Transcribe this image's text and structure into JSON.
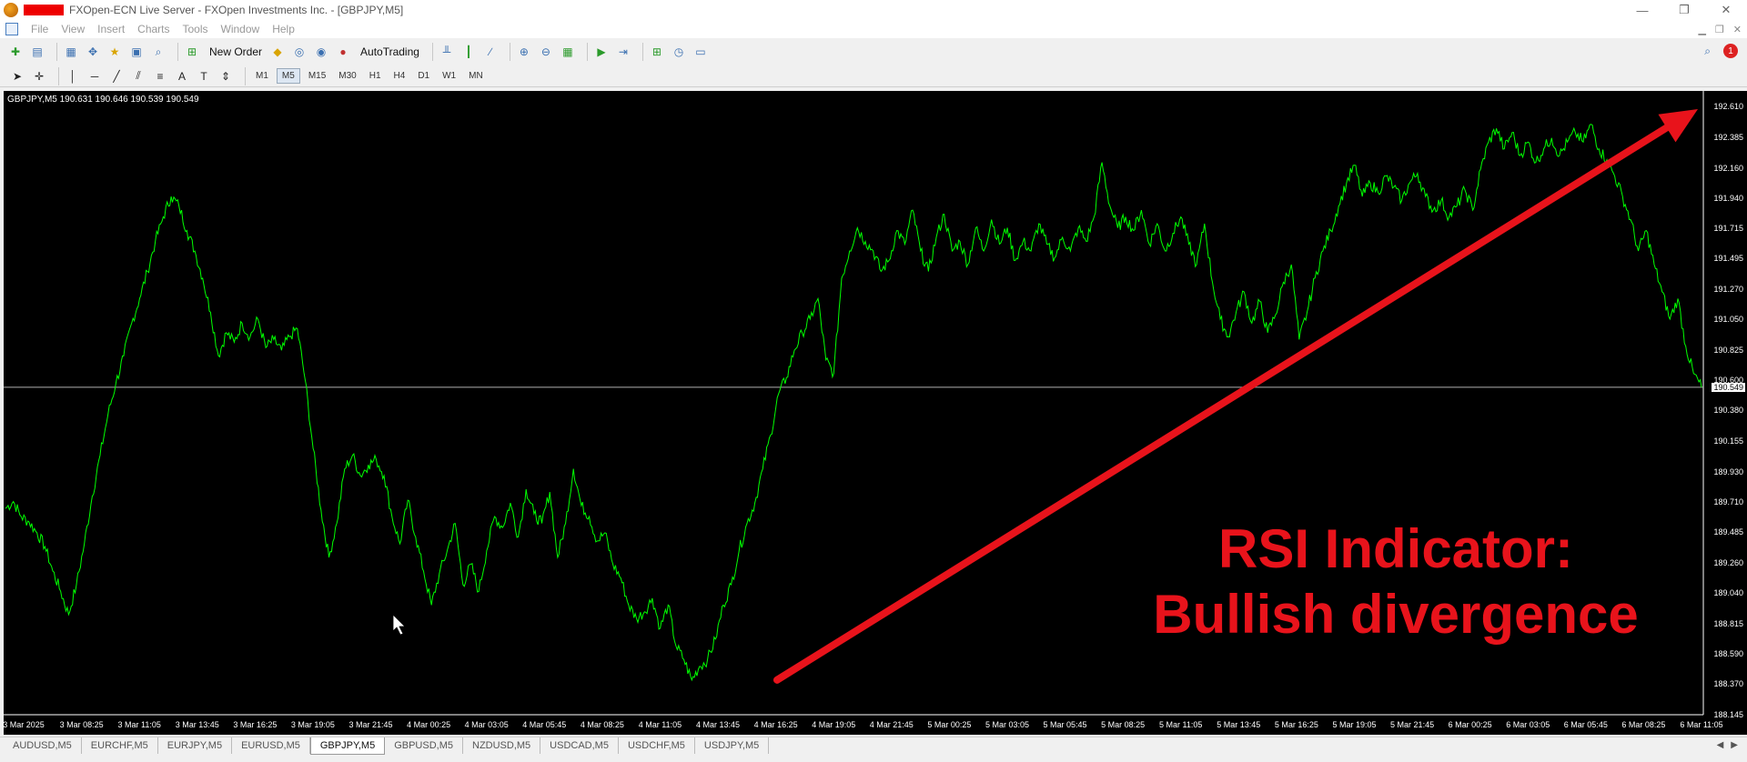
{
  "window": {
    "title": "FXOpen-ECN Live Server - FXOpen Investments Inc. - [GBPJPY,M5]",
    "controls": [
      "—",
      "❐",
      "✕"
    ]
  },
  "menu": {
    "items": [
      "File",
      "View",
      "Insert",
      "Charts",
      "Tools",
      "Window",
      "Help"
    ]
  },
  "toolbar": {
    "new_order_label": "New Order",
    "autotrading_label": "AutoTrading",
    "notification_count": "1"
  },
  "timeframes": {
    "items": [
      "M1",
      "M5",
      "M15",
      "M30",
      "H1",
      "H4",
      "D1",
      "W1",
      "MN"
    ],
    "active": "M5"
  },
  "chart": {
    "info_label": "GBPJPY,M5  190.631 190.646 190.539 190.549",
    "current_price": "190.549",
    "line_color": "#00ff00",
    "background": "#000000",
    "annotation_line1": "RSI Indicator:",
    "annotation_line2": "Bullish divergence",
    "annotation_color": "#e8131b",
    "arrow_color": "#e8131b"
  },
  "chart_data": {
    "type": "line",
    "series": [
      {
        "values": [
          189.66,
          189.71,
          189.6,
          189.56,
          189.48,
          189.38,
          189.2,
          189.05,
          188.88,
          189.1,
          189.4,
          189.75,
          190.05,
          190.35,
          190.58,
          190.78,
          191.02,
          191.2,
          191.4,
          191.62,
          191.8,
          191.95,
          191.88,
          191.7,
          191.55,
          191.35,
          191.1,
          190.78,
          190.95,
          190.88,
          191.02,
          190.92,
          191.05,
          190.84,
          190.9,
          190.82,
          190.92,
          190.98,
          190.6,
          190.1,
          189.65,
          189.3,
          189.55,
          189.95,
          190.05,
          189.9,
          189.98,
          190.02,
          189.9,
          189.6,
          189.4,
          189.72,
          189.45,
          189.2,
          188.95,
          189.18,
          189.35,
          189.55,
          189.1,
          189.25,
          189.05,
          189.35,
          189.6,
          189.52,
          189.7,
          189.45,
          189.8,
          189.62,
          189.55,
          189.78,
          189.3,
          189.55,
          189.95,
          189.68,
          189.6,
          189.42,
          189.48,
          189.25,
          189.15,
          188.95,
          188.85,
          188.9,
          189.0,
          188.78,
          188.95,
          188.65,
          188.55,
          188.4,
          188.5,
          188.55,
          188.7,
          188.95,
          189.1,
          189.35,
          189.55,
          189.7,
          189.95,
          190.2,
          190.5,
          190.62,
          190.82,
          190.95,
          191.05,
          191.2,
          190.75,
          190.65,
          191.35,
          191.55,
          191.72,
          191.62,
          191.55,
          191.4,
          191.48,
          191.7,
          191.6,
          191.85,
          191.55,
          191.4,
          191.65,
          191.82,
          191.55,
          191.62,
          191.45,
          191.72,
          191.55,
          191.78,
          191.6,
          191.72,
          191.48,
          191.62,
          191.55,
          191.75,
          191.6,
          191.5,
          191.65,
          191.55,
          191.72,
          191.62,
          191.8,
          192.2,
          191.88,
          191.72,
          191.8,
          191.7,
          191.85,
          191.6,
          191.75,
          191.55,
          191.68,
          191.8,
          191.6,
          191.45,
          191.75,
          191.32,
          191.05,
          190.92,
          191.1,
          191.25,
          191.02,
          191.18,
          190.95,
          191.08,
          191.32,
          191.45,
          190.9,
          191.1,
          191.35,
          191.55,
          191.7,
          191.88,
          192.05,
          192.18,
          191.95,
          192.05,
          191.98,
          192.1,
          192.02,
          191.92,
          192.05,
          192.12,
          191.95,
          191.85,
          191.92,
          191.8,
          191.88,
          192.0,
          191.85,
          192.15,
          192.35,
          192.45,
          192.3,
          192.42,
          192.25,
          192.35,
          192.2,
          192.3,
          192.38,
          192.25,
          192.35,
          192.42,
          192.35,
          192.48,
          192.3,
          192.22,
          192.1,
          191.95,
          191.78,
          191.55,
          191.7,
          191.45,
          191.25,
          191.05,
          191.2,
          190.85,
          190.65,
          190.549
        ]
      }
    ],
    "ylim": [
      188.145,
      192.725
    ],
    "yticks": [
      "192.610",
      "192.385",
      "192.160",
      "191.940",
      "191.715",
      "191.495",
      "191.270",
      "191.050",
      "190.825",
      "190.600",
      "190.380",
      "190.155",
      "189.930",
      "189.710",
      "189.485",
      "189.260",
      "189.040",
      "188.815",
      "188.590",
      "188.370",
      "188.145"
    ],
    "xticks": [
      "3 Mar 2025",
      "3 Mar 08:25",
      "3 Mar 11:05",
      "3 Mar 13:45",
      "3 Mar 16:25",
      "3 Mar 19:05",
      "3 Mar 21:45",
      "4 Mar 00:25",
      "4 Mar 03:05",
      "4 Mar 05:45",
      "4 Mar 08:25",
      "4 Mar 11:05",
      "4 Mar 13:45",
      "4 Mar 16:25",
      "4 Mar 19:05",
      "4 Mar 21:45",
      "5 Mar 00:25",
      "5 Mar 03:05",
      "5 Mar 05:45",
      "5 Mar 08:25",
      "5 Mar 11:05",
      "5 Mar 13:45",
      "5 Mar 16:25",
      "5 Mar 19:05",
      "5 Mar 21:45",
      "6 Mar 00:25",
      "6 Mar 03:05",
      "6 Mar 05:45",
      "6 Mar 08:25",
      "6 Mar 11:05"
    ],
    "current_price_line": 190.549,
    "grid": false
  },
  "tabs": {
    "items": [
      "AUDUSD,M5",
      "EURCHF,M5",
      "EURJPY,M5",
      "EURUSD,M5",
      "GBPJPY,M5",
      "GBPUSD,M5",
      "NZDUSD,M5",
      "USDCAD,M5",
      "USDCHF,M5",
      "USDJPY,M5"
    ],
    "active": "GBPJPY,M5"
  }
}
